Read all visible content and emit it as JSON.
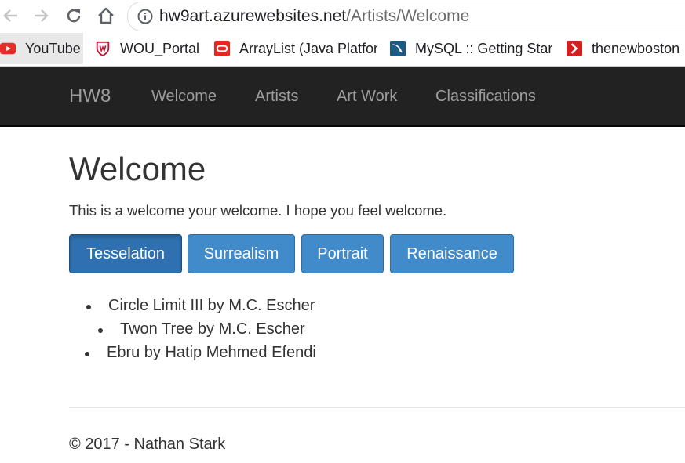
{
  "browser": {
    "url_host": "hw9art.azurewebsites.net",
    "url_path": "/Artists/Welcome",
    "bookmarks": [
      {
        "label": "YouTube",
        "icon": "youtube-icon"
      },
      {
        "label": "WOU_Portal",
        "icon": "wou-icon"
      },
      {
        "label": "ArrayList (Java Platfor",
        "icon": "oracle-icon"
      },
      {
        "label": "MySQL :: Getting Star",
        "icon": "mysql-icon"
      },
      {
        "label": "thenewboston",
        "icon": "thenewboston-icon"
      }
    ]
  },
  "navbar": {
    "brand": "HW8",
    "links": [
      "Welcome",
      "Artists",
      "Art Work",
      "Classifications"
    ],
    "bg_color": "#222222"
  },
  "page": {
    "title": "Welcome",
    "lead": "This is a welcome your welcome. I hope you feel welcome.",
    "buttons": [
      "Tesselation",
      "Surrealism",
      "Portrait",
      "Renaissance"
    ],
    "active_button": "Tesselation",
    "button_color": "#428bca",
    "items": [
      "Circle Limit III by M.C. Escher",
      "Twon Tree by M.C. Escher",
      "Ebru by Hatip Mehmed Efendi"
    ]
  },
  "footer": {
    "text": "© 2017 - Nathan Stark"
  }
}
